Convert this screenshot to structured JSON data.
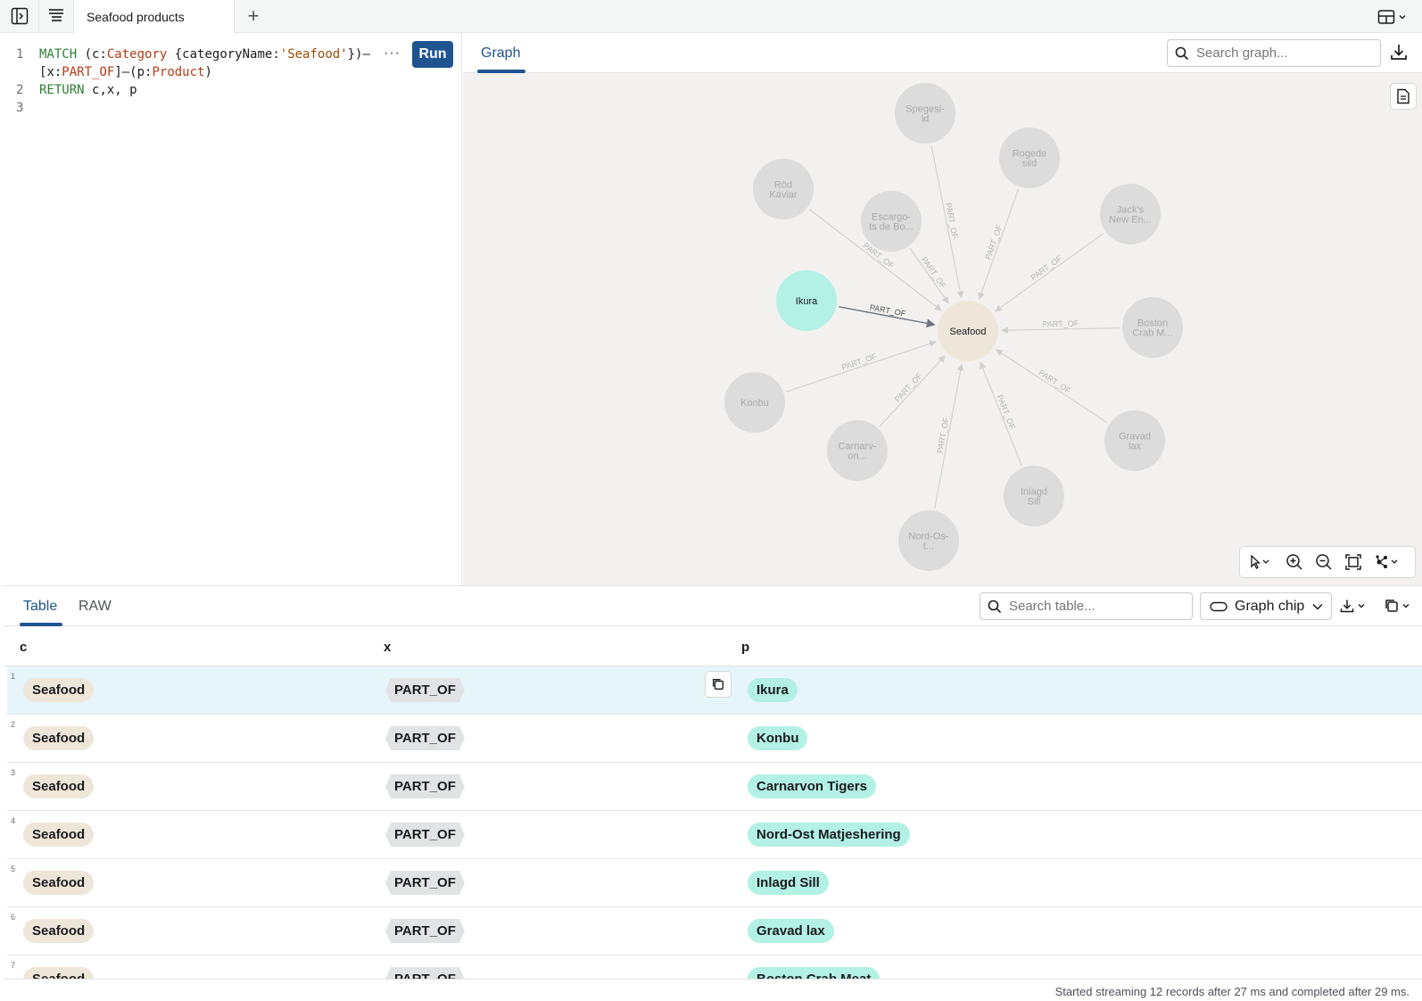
{
  "topbar": {
    "tab_title": "Seafood products",
    "add_tab": "+"
  },
  "editor": {
    "lines": [
      {
        "n": "1",
        "tokens": [
          [
            "kw",
            "MATCH "
          ],
          [
            "plain",
            "(c:"
          ],
          [
            "lbl",
            "Category"
          ],
          [
            "plain",
            " {"
          ],
          [
            "prop",
            "categoryName"
          ],
          [
            "plain",
            ":"
          ],
          [
            "str",
            "'Seafood'"
          ],
          [
            "plain",
            "})–"
          ]
        ]
      },
      {
        "n": "",
        "tokens": [
          [
            "plain",
            "["
          ],
          [
            "plain",
            "x:"
          ],
          [
            "lbl",
            "PART_OF"
          ],
          [
            "plain",
            "]–(p:"
          ],
          [
            "lbl",
            "Product"
          ],
          [
            "plain",
            ")"
          ]
        ]
      },
      {
        "n": "2",
        "tokens": [
          [
            "kw",
            "RETURN "
          ],
          [
            "plain",
            "c,x, p"
          ]
        ]
      },
      {
        "n": "3",
        "tokens": []
      }
    ],
    "more": "···",
    "run_label": "Run"
  },
  "graph": {
    "tab_label": "Graph",
    "search_placeholder": "Search graph...",
    "center": "Seafood",
    "rel_label": "PART_OF",
    "nodes": [
      {
        "label": [
          "Spegesi-",
          "ld"
        ]
      },
      {
        "label": [
          "Rogede",
          "sild"
        ]
      },
      {
        "label": [
          "Jack's",
          "New En..."
        ]
      },
      {
        "label": [
          "Boston",
          "Crab M..."
        ]
      },
      {
        "label": [
          "Gravad",
          "lax"
        ]
      },
      {
        "label": [
          "Inlagd",
          "Sill"
        ]
      },
      {
        "label": [
          "Nord-Os-",
          "t..."
        ]
      },
      {
        "label": [
          "Carnarv-",
          "on..."
        ]
      },
      {
        "label": [
          "Konbu"
        ]
      },
      {
        "label": [
          "Ikura"
        ],
        "selected": true
      },
      {
        "label": [
          "Röd",
          "Kaviar"
        ]
      },
      {
        "label": [
          "Escargo-",
          "ts de Bo..."
        ]
      }
    ],
    "colors": {
      "category": "#efe6da",
      "selected": "#b2f1e4",
      "dimmed": "#dcdcdc"
    }
  },
  "results": {
    "tabs": [
      "Table",
      "RAW"
    ],
    "search_placeholder": "Search table...",
    "chip_select": "Graph chip",
    "columns": [
      "c",
      "x",
      "p"
    ],
    "rows": [
      {
        "n": "1",
        "c": "Seafood",
        "x": "PART_OF",
        "p": "Ikura"
      },
      {
        "n": "2",
        "c": "Seafood",
        "x": "PART_OF",
        "p": "Konbu"
      },
      {
        "n": "3",
        "c": "Seafood",
        "x": "PART_OF",
        "p": "Carnarvon Tigers"
      },
      {
        "n": "4",
        "c": "Seafood",
        "x": "PART_OF",
        "p": "Nord-Ost Matjeshering"
      },
      {
        "n": "5",
        "c": "Seafood",
        "x": "PART_OF",
        "p": "Inlagd Sill"
      },
      {
        "n": "6",
        "c": "Seafood",
        "x": "PART_OF",
        "p": "Gravad lax"
      },
      {
        "n": "7",
        "c": "Seafood",
        "x": "PART_OF",
        "p": "Boston Crab Meat"
      }
    ],
    "status": "Started streaming 12 records after 27 ms and completed after 29 ms."
  }
}
